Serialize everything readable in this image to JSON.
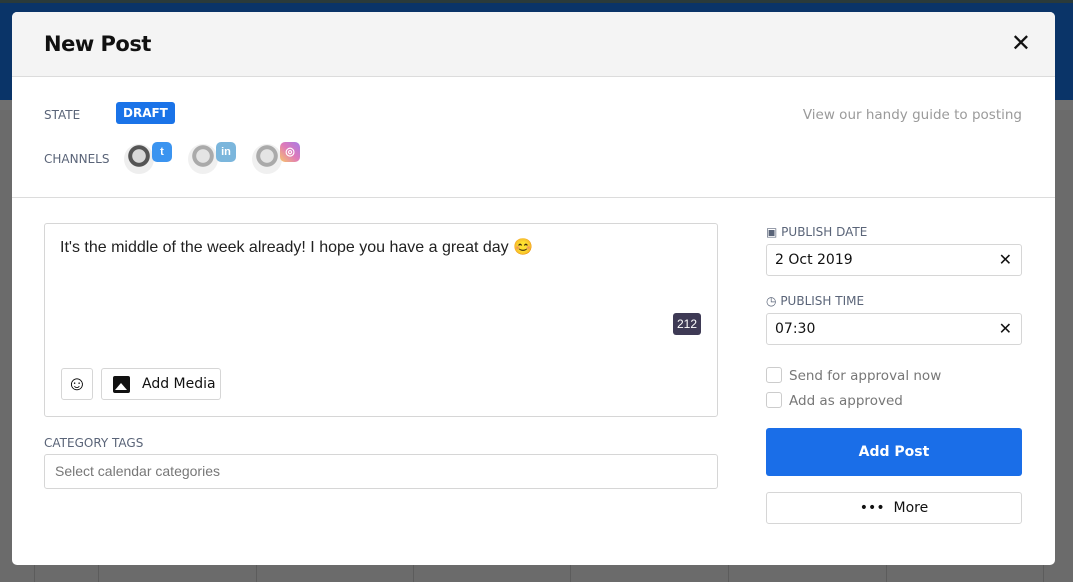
{
  "modal": {
    "title": "New Post",
    "close_icon": "close-icon"
  },
  "meta": {
    "state_label": "STATE",
    "state_value": "DRAFT",
    "channels_label": "CHANNELS",
    "guide_link": "View our handy guide to posting",
    "channels": [
      {
        "network": "twitter",
        "color": "#3b94f0"
      },
      {
        "network": "linkedin",
        "color": "#7bb6dc"
      },
      {
        "network": "instagram",
        "color": "#e07ab8"
      }
    ]
  },
  "editor": {
    "text": "It's the middle of the week already!  I hope you have a great day 😊",
    "char_count": "212",
    "emoji_button": "☺",
    "add_media": "Add Media"
  },
  "tags": {
    "label": "CATEGORY TAGS",
    "placeholder": "Select calendar categories"
  },
  "schedule": {
    "date_label": "PUBLISH DATE",
    "date_value": "2 Oct 2019",
    "time_label": "PUBLISH TIME",
    "time_value": "07:30",
    "clear": "✕"
  },
  "options": {
    "send_for_approval": "Send for approval now",
    "add_as_approved": "Add as approved",
    "send_for_approval_checked": false,
    "add_as_approved_checked": false
  },
  "actions": {
    "add_post": "Add Post",
    "more": "More",
    "more_icon": "•••"
  },
  "colors": {
    "primary": "#1a6ee8",
    "badge": "#1a73e8"
  }
}
